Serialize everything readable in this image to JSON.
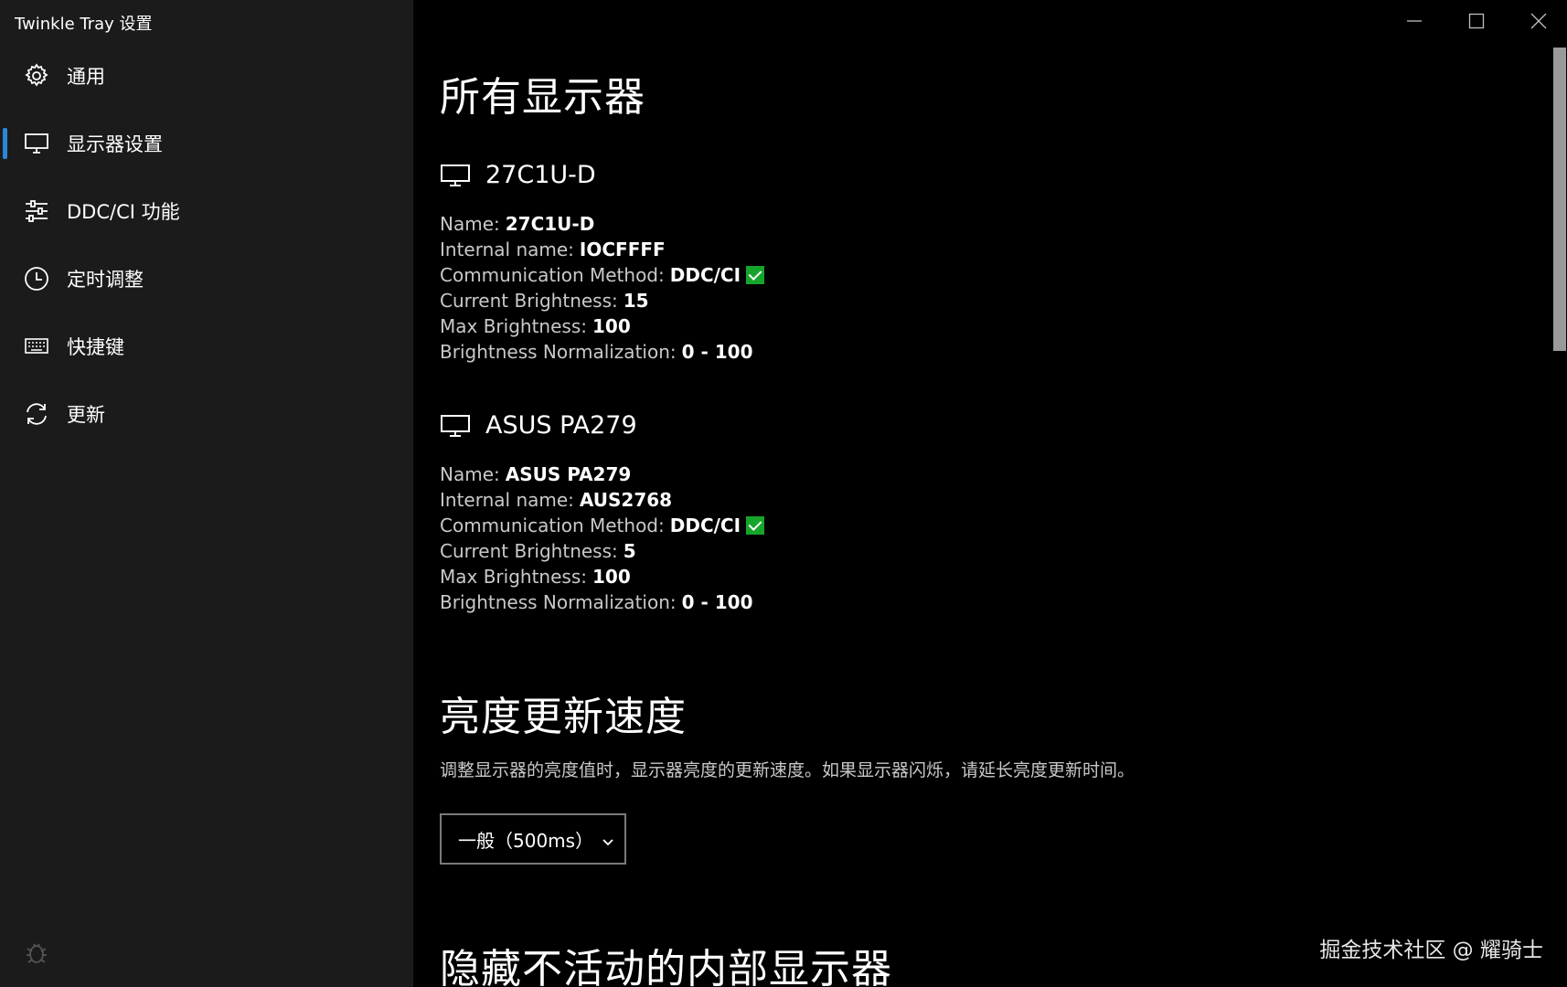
{
  "window": {
    "title": "Twinkle Tray 设置"
  },
  "sidebar": {
    "items": [
      {
        "label": "通用",
        "icon": "gear-icon"
      },
      {
        "label": "显示器设置",
        "icon": "monitor-icon",
        "active": true
      },
      {
        "label": "DDC/CI 功能",
        "icon": "sliders-icon"
      },
      {
        "label": "定时调整",
        "icon": "clock-icon"
      },
      {
        "label": "快捷键",
        "icon": "keyboard-icon"
      },
      {
        "label": "更新",
        "icon": "refresh-icon"
      }
    ]
  },
  "main": {
    "all_monitors_heading": "所有显示器",
    "monitors": [
      {
        "title": "27C1U-D",
        "name_label": "Name:",
        "name": "27C1U-D",
        "internal_label": "Internal name:",
        "internal": "IOCFFFF",
        "method_label": "Communication Method:",
        "method": "DDC/CI",
        "current_label": "Current Brightness:",
        "current": "15",
        "max_label": "Max Brightness:",
        "max": "100",
        "norm_label": "Brightness Normalization:",
        "norm": "0 - 100"
      },
      {
        "title": "ASUS PA279",
        "name_label": "Name:",
        "name": "ASUS PA279",
        "internal_label": "Internal name:",
        "internal": "AUS2768",
        "method_label": "Communication Method:",
        "method": "DDC/CI",
        "current_label": "Current Brightness:",
        "current": "5",
        "max_label": "Max Brightness:",
        "max": "100",
        "norm_label": "Brightness Normalization:",
        "norm": "0 - 100"
      }
    ],
    "speed_heading": "亮度更新速度",
    "speed_description": "调整显示器的亮度值时，显示器亮度的更新速度。如果显示器闪烁，请延长亮度更新时间。",
    "speed_select_value": "一般（500ms）",
    "hide_heading": "隐藏不活动的内部显示器"
  },
  "watermark": "掘金技术社区 @ 耀骑士",
  "colors": {
    "accent": "#2b86d9",
    "check": "#16a52b",
    "sidebar_bg": "#1b1b1b",
    "main_bg": "#000000"
  }
}
